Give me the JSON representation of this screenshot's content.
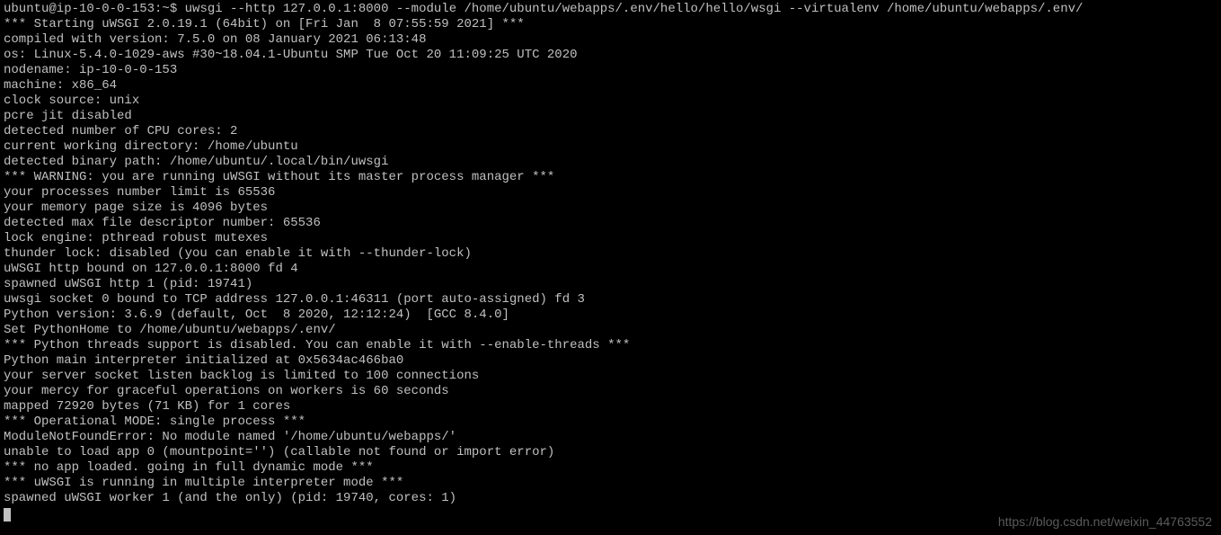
{
  "terminal": {
    "prompt": "ubuntu@ip-10-0-0-153:~$ ",
    "command": "uwsgi --http 127.0.0.1:8000 --module /home/ubuntu/webapps/.env/hello/hello/wsgi --virtualenv /home/ubuntu/webapps/.env/",
    "lines": [
      "*** Starting uWSGI 2.0.19.1 (64bit) on [Fri Jan  8 07:55:59 2021] ***",
      "compiled with version: 7.5.0 on 08 January 2021 06:13:48",
      "os: Linux-5.4.0-1029-aws #30~18.04.1-Ubuntu SMP Tue Oct 20 11:09:25 UTC 2020",
      "nodename: ip-10-0-0-153",
      "machine: x86_64",
      "clock source: unix",
      "pcre jit disabled",
      "detected number of CPU cores: 2",
      "current working directory: /home/ubuntu",
      "detected binary path: /home/ubuntu/.local/bin/uwsgi",
      "*** WARNING: you are running uWSGI without its master process manager ***",
      "your processes number limit is 65536",
      "your memory page size is 4096 bytes",
      "detected max file descriptor number: 65536",
      "lock engine: pthread robust mutexes",
      "thunder lock: disabled (you can enable it with --thunder-lock)",
      "uWSGI http bound on 127.0.0.1:8000 fd 4",
      "spawned uWSGI http 1 (pid: 19741)",
      "uwsgi socket 0 bound to TCP address 127.0.0.1:46311 (port auto-assigned) fd 3",
      "Python version: 3.6.9 (default, Oct  8 2020, 12:12:24)  [GCC 8.4.0]",
      "Set PythonHome to /home/ubuntu/webapps/.env/",
      "*** Python threads support is disabled. You can enable it with --enable-threads ***",
      "Python main interpreter initialized at 0x5634ac466ba0",
      "your server socket listen backlog is limited to 100 connections",
      "your mercy for graceful operations on workers is 60 seconds",
      "mapped 72920 bytes (71 KB) for 1 cores",
      "*** Operational MODE: single process ***",
      "ModuleNotFoundError: No module named '/home/ubuntu/webapps/'",
      "unable to load app 0 (mountpoint='') (callable not found or import error)",
      "*** no app loaded. going in full dynamic mode ***",
      "*** uWSGI is running in multiple interpreter mode ***",
      "spawned uWSGI worker 1 (and the only) (pid: 19740, cores: 1)"
    ]
  },
  "watermark": "https://blog.csdn.net/weixin_44763552"
}
